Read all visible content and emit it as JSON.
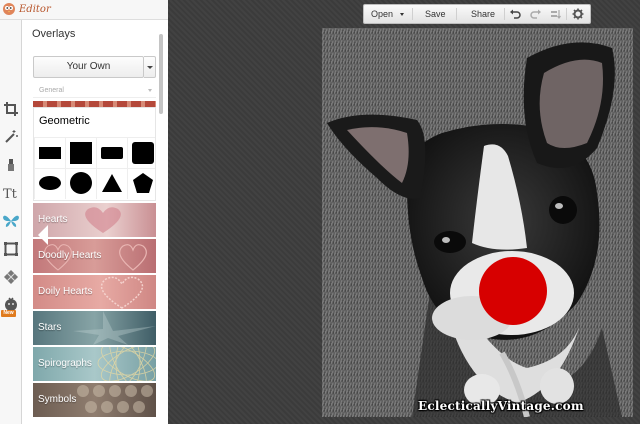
{
  "app": {
    "title": "Editor",
    "logo_icon": "bird-logo-icon"
  },
  "rail": {
    "tools": [
      {
        "icon": "crop-icon"
      },
      {
        "icon": "magic-wand-icon"
      },
      {
        "icon": "touchup-brush-icon"
      },
      {
        "icon": "text-icon"
      },
      {
        "icon": "butterfly-overlay-icon"
      },
      {
        "icon": "frame-icon"
      },
      {
        "icon": "texture-icon"
      },
      {
        "icon": "seasonal-icon"
      }
    ],
    "new_badge": "New"
  },
  "panel": {
    "title": "Overlays",
    "your_own_label": "Your Own",
    "category": "General",
    "categories": [
      {
        "label": "Geometric"
      },
      {
        "label": "Hearts",
        "color": "#d4a0a3"
      },
      {
        "label": "Doodly Hearts",
        "color": "#c9837f"
      },
      {
        "label": "Doily Hearts",
        "color": "#d98f8a"
      },
      {
        "label": "Stars",
        "color": "#6c8b91"
      },
      {
        "label": "Spirographs",
        "color": "#8ab2b6"
      },
      {
        "label": "Symbols",
        "color": "#7d6c60"
      }
    ],
    "shapes": [
      "rectangle",
      "square",
      "rounded-rectangle",
      "rounded-square",
      "ellipse",
      "circle",
      "triangle",
      "pentagon"
    ]
  },
  "toolbar": {
    "open_label": "Open",
    "save_label": "Save",
    "share_label": "Share"
  },
  "photo": {
    "nose_color": "#d70000",
    "watermark": "EclecticallyVintage.com"
  }
}
